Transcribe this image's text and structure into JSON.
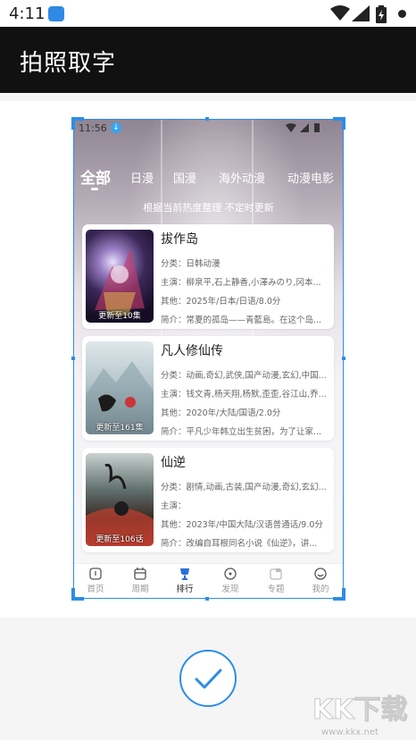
{
  "status_bar": {
    "time": "4:11"
  },
  "title_bar": {
    "title": "拍照取字"
  },
  "captured": {
    "status_time": "11:56",
    "tabs": [
      "全部",
      "日漫",
      "国漫",
      "海外动漫",
      "动漫电影"
    ],
    "active_tab": "全部",
    "subtitle": "根据当前热度整理 不定时更新",
    "items": [
      {
        "title": "拔作岛",
        "category": "分类：日韩动漫",
        "cast": "主演：柳泉平,石上静香,小澤みのり,冈本...",
        "other": "其他：2025年/日本/日语/8.0分",
        "intro": "简介：常夏的孤岛——青藍島。在这个岛...",
        "badge": "更新至10集"
      },
      {
        "title": "凡人修仙传",
        "category": "分类：动画,奇幻,武侠,国产动漫,玄幻,中国...",
        "cast": "主演：钱文青,杨天翔,杨默,歪歪,谷江山,乔...",
        "other": "其他：2020年/大陆/国语/2.0分",
        "intro": "简介：平凡少年韩立出生贫困，为了让家...",
        "badge": "更新至161集"
      },
      {
        "title": "仙逆",
        "category": "分类：剧情,动画,古装,国产动漫,奇幻,玄幻...",
        "cast": "主演：",
        "other": "其他：2023年/中国大陆/汉语普通话/9.0分",
        "intro": "简介：改编自耳根同名小说《仙逆》，讲...",
        "badge": "更新至106话"
      }
    ],
    "nav": [
      "首页",
      "周期",
      "排行",
      "发现",
      "专题",
      "我的"
    ],
    "active_nav": "排行"
  },
  "watermark": {
    "text": "KK下载",
    "url_text": "www.kkx.net"
  },
  "colors": {
    "accent": "#2c8de8",
    "title_bg": "#111111"
  }
}
